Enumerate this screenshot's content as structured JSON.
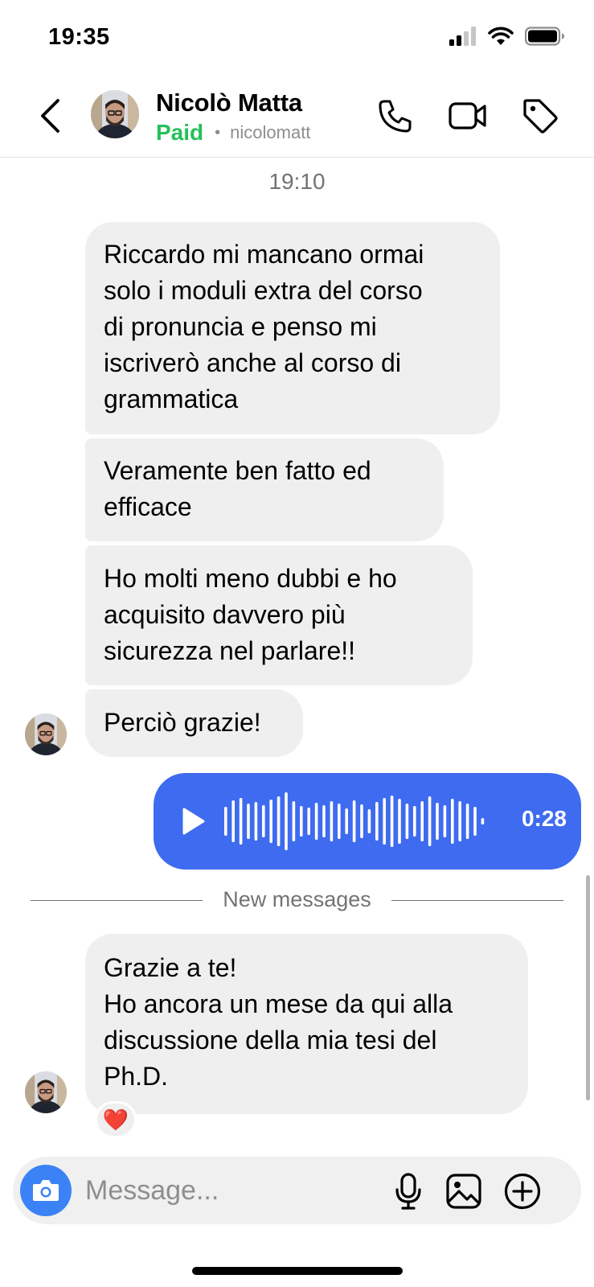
{
  "status_bar": {
    "time": "19:35"
  },
  "header": {
    "name": "Nicolò Matta",
    "status": "Paid",
    "username": "nicolomatt",
    "icons": [
      "back-chevron-icon",
      "phone-icon",
      "video-camera-icon",
      "tag-icon"
    ]
  },
  "chat": {
    "timestamp": "19:10",
    "incoming_group_1": [
      {
        "lines": [
          "Riccardo mi mancano ormai",
          "solo i moduli extra del corso",
          "di pronuncia e penso mi",
          "iscriverò anche al corso di",
          "grammatica"
        ]
      },
      {
        "lines": [
          "Veramente ben fatto ed",
          "efficace"
        ]
      },
      {
        "lines": [
          "Ho molti meno dubbi e ho",
          "acquisito davvero più",
          "sicurezza nel parlare!!"
        ]
      },
      {
        "lines": [
          "Perciò grazie!"
        ]
      }
    ],
    "voice_message": {
      "duration": "0:28",
      "icon": "play-icon"
    },
    "new_messages_label": "New messages",
    "incoming_group_2": [
      {
        "lines": [
          "Grazie a te!",
          "Ho ancora un mese da qui alla",
          "discussione della mia tesi del",
          "Ph.D."
        ],
        "reaction": "❤️"
      }
    ]
  },
  "composer": {
    "placeholder": "Message...",
    "icons": [
      "camera-icon",
      "microphone-icon",
      "gallery-icon",
      "add-circle-icon"
    ]
  },
  "colors": {
    "paid_green": "#25c05a",
    "voice_bubble": "#3e6bef",
    "camera_button": "#3b82f6",
    "incoming_bubble": "#efefef"
  }
}
